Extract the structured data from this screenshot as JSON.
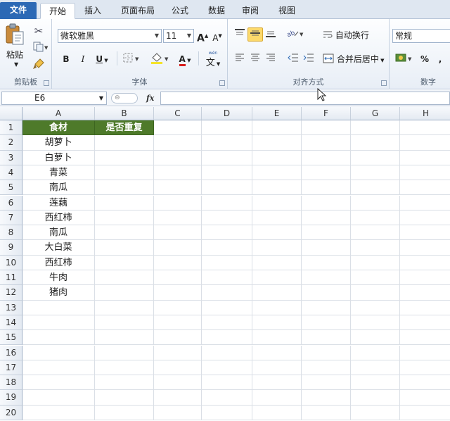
{
  "tabs": [
    "文件",
    "开始",
    "插入",
    "页面布局",
    "公式",
    "数据",
    "审阅",
    "视图"
  ],
  "ribbon": {
    "clipboard": {
      "label": "剪贴板",
      "paste": "粘贴"
    },
    "font": {
      "label": "字体",
      "name": "微软雅黑",
      "size": "11",
      "bold": "B",
      "italic": "I",
      "underline": "U",
      "grow": "A",
      "shrink": "A",
      "font_color": "A",
      "phonetic": "文"
    },
    "alignment": {
      "label": "对齐方式",
      "wrap_text": "自动换行",
      "merge_center": "合并后居中"
    },
    "number": {
      "label": "数字",
      "format": "常规",
      "percent": "%",
      "comma": ","
    }
  },
  "formula_bar": {
    "name_box": "E6",
    "fx": "fx",
    "content": ""
  },
  "columns": [
    "A",
    "B",
    "C",
    "D",
    "E",
    "F",
    "G",
    "H"
  ],
  "rows": [
    "1",
    "2",
    "3",
    "4",
    "5",
    "6",
    "7",
    "8",
    "9",
    "10",
    "11",
    "12",
    "13",
    "14",
    "15",
    "16",
    "17",
    "18",
    "19",
    "20"
  ],
  "cells": {
    "A1": "食材",
    "B1": "是否重复",
    "A2": "胡萝卜",
    "A3": "白萝卜",
    "A4": "青菜",
    "A5": "南瓜",
    "A6": "莲藕",
    "A7": "西红柿",
    "A8": "南瓜",
    "A9": "大白菜",
    "A10": "西红柿",
    "A11": "牛肉",
    "A12": "猪肉"
  },
  "colors": {
    "header_fill": "#4e7a2a",
    "file_tab": "#2c69b5",
    "selected_button": "#fcd96b"
  }
}
